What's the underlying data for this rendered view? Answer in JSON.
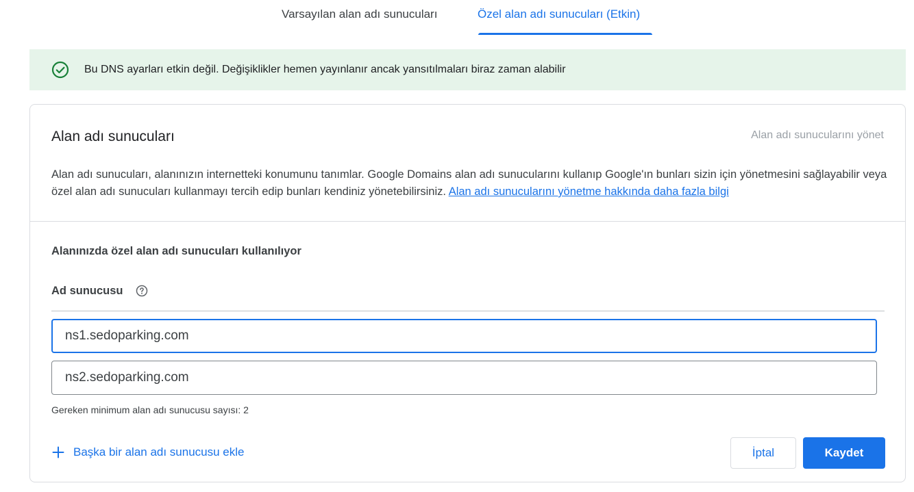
{
  "tabs": {
    "default_label": "Varsayılan alan adı sunucuları",
    "custom_label": "Özel alan adı sunucuları (Etkin)",
    "active": "custom"
  },
  "banner": {
    "icon": "check-circle-icon",
    "text": "Bu DNS ayarları etkin değil. Değişiklikler hemen yayınlanır ancak yansıtılmaları biraz zaman alabilir"
  },
  "card": {
    "title": "Alan adı sunucuları",
    "manage_label": "Alan adı sunucularını yönet",
    "description": "Alan adı sunucuları, alanınızın internetteki konumunu tanımlar. Google Domains alan adı sunucularını kullanıp Google'ın bunları sizin için yönetmesini sağlayabilir veya özel alan adı sunucuları kullanmayı tercih edip bunları kendiniz yönetebilirsiniz.",
    "learn_more_link": "Alan adı sunucularını yönetme hakkında daha fazla bilgi",
    "section_heading": "Alanınızda özel alan adı sunucuları kullanılıyor",
    "ns_label": "Ad sunucusu",
    "name_servers": [
      {
        "value": "ns1.sedoparking.com"
      },
      {
        "value": "ns2.sedoparking.com"
      }
    ],
    "min_servers_text": "Gereken minimum alan adı sunucusu sayısı: 2",
    "add_server_label": "Başka bir alan adı sunucusu ekle",
    "cancel_label": "İptal",
    "save_label": "Kaydet"
  },
  "colors": {
    "accent": "#1a73e8",
    "banner_bg": "#e6f4ea",
    "success": "#188038"
  }
}
